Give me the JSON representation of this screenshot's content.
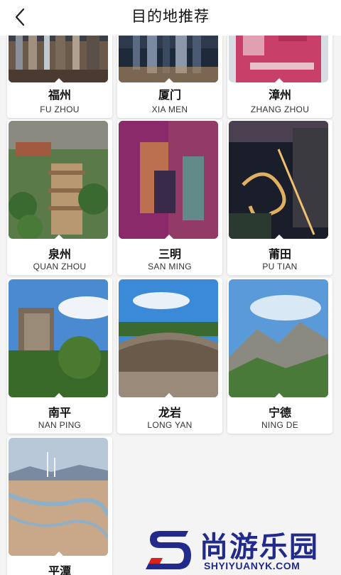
{
  "header": {
    "title": "目的地推荐"
  },
  "destinations": [
    {
      "cn": "福州",
      "en": "FU ZHOU"
    },
    {
      "cn": "厦门",
      "en": "XIA MEN"
    },
    {
      "cn": "漳州",
      "en": "ZHANG ZHOU"
    },
    {
      "cn": "泉州",
      "en": "QUAN ZHOU"
    },
    {
      "cn": "三明",
      "en": "SAN MING"
    },
    {
      "cn": "莆田",
      "en": "PU TIAN"
    },
    {
      "cn": "南平",
      "en": "NAN PING"
    },
    {
      "cn": "龙岩",
      "en": "LONG YAN"
    },
    {
      "cn": "宁德",
      "en": "NING DE"
    },
    {
      "cn": "平潭",
      "en": ""
    }
  ],
  "watermark": {
    "name": "尚游乐园",
    "url": "SHYIYUANYK.COM"
  }
}
